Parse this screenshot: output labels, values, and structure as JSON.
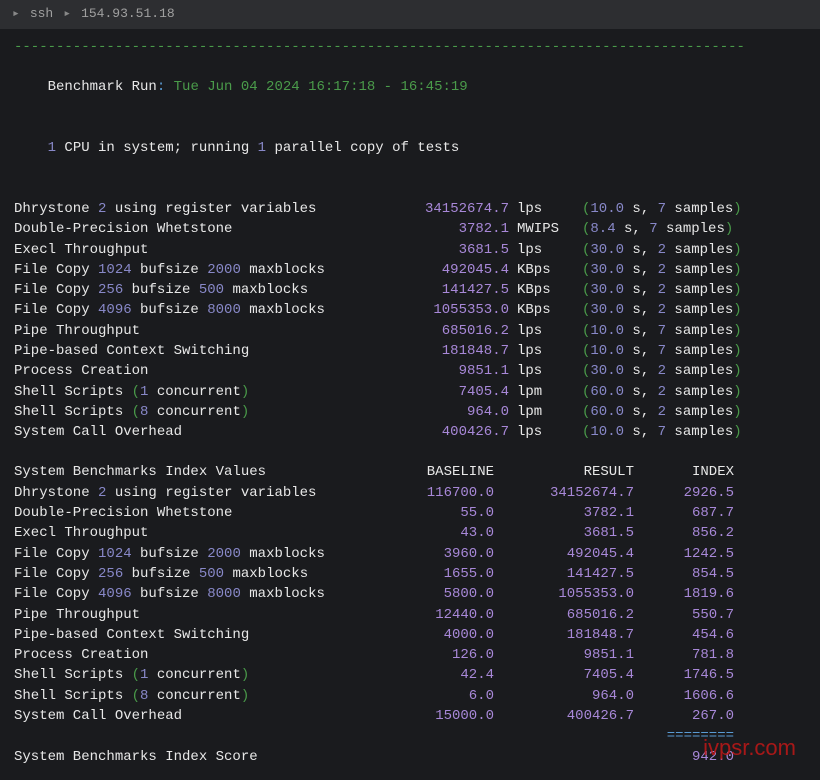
{
  "titlebar": {
    "label_ssh": "ssh",
    "ip": "154.93.51.18",
    "arrow": "▸"
  },
  "header": {
    "dashes": "---------------------------------------------------------------------------------------",
    "run_label": "Benchmark Run",
    "run_time": "Tue Jun 04 2024 16:17:18 - 16:45:19",
    "cpu_count": "1",
    "cpu_text1": " CPU in system; running ",
    "copies": "1",
    "cpu_text2": " parallel copy of tests"
  },
  "tests": [
    {
      "name_parts": [
        {
          "t": "Dhrystone ",
          "c": "c-white"
        },
        {
          "t": "2",
          "c": "c-num"
        },
        {
          "t": " using register variables",
          "c": "c-white"
        }
      ],
      "value": "34152674.7",
      "unit": "lps",
      "time": "10.0",
      "samples": "7"
    },
    {
      "name_parts": [
        {
          "t": "Double-Precision Whetstone",
          "c": "c-white"
        }
      ],
      "value": "3782.1",
      "unit": "MWIPS",
      "time": "8.4",
      "samples": "7"
    },
    {
      "name_parts": [
        {
          "t": "Execl Throughput",
          "c": "c-white"
        }
      ],
      "value": "3681.5",
      "unit": "lps",
      "time": "30.0",
      "samples": "2"
    },
    {
      "name_parts": [
        {
          "t": "File Copy ",
          "c": "c-white"
        },
        {
          "t": "1024",
          "c": "c-num"
        },
        {
          "t": " bufsize ",
          "c": "c-white"
        },
        {
          "t": "2000",
          "c": "c-num"
        },
        {
          "t": " maxblocks",
          "c": "c-white"
        }
      ],
      "value": "492045.4",
      "unit": "KBps",
      "time": "30.0",
      "samples": "2"
    },
    {
      "name_parts": [
        {
          "t": "File Copy ",
          "c": "c-white"
        },
        {
          "t": "256",
          "c": "c-num"
        },
        {
          "t": " bufsize ",
          "c": "c-white"
        },
        {
          "t": "500",
          "c": "c-num"
        },
        {
          "t": " maxblocks",
          "c": "c-white"
        }
      ],
      "value": "141427.5",
      "unit": "KBps",
      "time": "30.0",
      "samples": "2"
    },
    {
      "name_parts": [
        {
          "t": "File Copy ",
          "c": "c-white"
        },
        {
          "t": "4096",
          "c": "c-num"
        },
        {
          "t": " bufsize ",
          "c": "c-white"
        },
        {
          "t": "8000",
          "c": "c-num"
        },
        {
          "t": " maxblocks",
          "c": "c-white"
        }
      ],
      "value": "1055353.0",
      "unit": "KBps",
      "time": "30.0",
      "samples": "2"
    },
    {
      "name_parts": [
        {
          "t": "Pipe Throughput",
          "c": "c-white"
        }
      ],
      "value": "685016.2",
      "unit": "lps",
      "time": "10.0",
      "samples": "7"
    },
    {
      "name_parts": [
        {
          "t": "Pipe-based Context Switching",
          "c": "c-white"
        }
      ],
      "value": "181848.7",
      "unit": "lps",
      "time": "10.0",
      "samples": "7"
    },
    {
      "name_parts": [
        {
          "t": "Process Creation",
          "c": "c-white"
        }
      ],
      "value": "9851.1",
      "unit": "lps",
      "time": "30.0",
      "samples": "2"
    },
    {
      "name_parts": [
        {
          "t": "Shell Scripts ",
          "c": "c-white"
        },
        {
          "t": "(",
          "c": "c-green"
        },
        {
          "t": "1",
          "c": "c-num"
        },
        {
          "t": " concurrent",
          "c": "c-white"
        },
        {
          "t": ")",
          "c": "c-green"
        }
      ],
      "value": "7405.4",
      "unit": "lpm",
      "time": "60.0",
      "samples": "2"
    },
    {
      "name_parts": [
        {
          "t": "Shell Scripts ",
          "c": "c-white"
        },
        {
          "t": "(",
          "c": "c-green"
        },
        {
          "t": "8",
          "c": "c-num"
        },
        {
          "t": " concurrent",
          "c": "c-white"
        },
        {
          "t": ")",
          "c": "c-green"
        }
      ],
      "value": "964.0",
      "unit": "lpm",
      "time": "60.0",
      "samples": "2"
    },
    {
      "name_parts": [
        {
          "t": "System Call Overhead",
          "c": "c-white"
        }
      ],
      "value": "400426.7",
      "unit": "lps",
      "time": "10.0",
      "samples": "7"
    }
  ],
  "test_det": {
    "open": "(",
    "close": ")",
    "s": " s, ",
    "samples": " samples"
  },
  "index_header": {
    "name": "System Benchmarks Index Values",
    "base": "BASELINE",
    "res": "RESULT",
    "idx": "INDEX"
  },
  "indices": [
    {
      "name_parts": [
        {
          "t": "Dhrystone ",
          "c": "c-white"
        },
        {
          "t": "2",
          "c": "c-num"
        },
        {
          "t": " using register variables",
          "c": "c-white"
        }
      ],
      "base": "116700.0",
      "res": "34152674.7",
      "idx": "2926.5"
    },
    {
      "name_parts": [
        {
          "t": "Double-Precision Whetstone",
          "c": "c-white"
        }
      ],
      "base": "55.0",
      "res": "3782.1",
      "idx": "687.7"
    },
    {
      "name_parts": [
        {
          "t": "Execl Throughput",
          "c": "c-white"
        }
      ],
      "base": "43.0",
      "res": "3681.5",
      "idx": "856.2"
    },
    {
      "name_parts": [
        {
          "t": "File Copy ",
          "c": "c-white"
        },
        {
          "t": "1024",
          "c": "c-num"
        },
        {
          "t": " bufsize ",
          "c": "c-white"
        },
        {
          "t": "2000",
          "c": "c-num"
        },
        {
          "t": " maxblocks",
          "c": "c-white"
        }
      ],
      "base": "3960.0",
      "res": "492045.4",
      "idx": "1242.5"
    },
    {
      "name_parts": [
        {
          "t": "File Copy ",
          "c": "c-white"
        },
        {
          "t": "256",
          "c": "c-num"
        },
        {
          "t": " bufsize ",
          "c": "c-white"
        },
        {
          "t": "500",
          "c": "c-num"
        },
        {
          "t": " maxblocks",
          "c": "c-white"
        }
      ],
      "base": "1655.0",
      "res": "141427.5",
      "idx": "854.5"
    },
    {
      "name_parts": [
        {
          "t": "File Copy ",
          "c": "c-white"
        },
        {
          "t": "4096",
          "c": "c-num"
        },
        {
          "t": " bufsize ",
          "c": "c-white"
        },
        {
          "t": "8000",
          "c": "c-num"
        },
        {
          "t": " maxblocks",
          "c": "c-white"
        }
      ],
      "base": "5800.0",
      "res": "1055353.0",
      "idx": "1819.6"
    },
    {
      "name_parts": [
        {
          "t": "Pipe Throughput",
          "c": "c-white"
        }
      ],
      "base": "12440.0",
      "res": "685016.2",
      "idx": "550.7"
    },
    {
      "name_parts": [
        {
          "t": "Pipe-based Context Switching",
          "c": "c-white"
        }
      ],
      "base": "4000.0",
      "res": "181848.7",
      "idx": "454.6"
    },
    {
      "name_parts": [
        {
          "t": "Process Creation",
          "c": "c-white"
        }
      ],
      "base": "126.0",
      "res": "9851.1",
      "idx": "781.8"
    },
    {
      "name_parts": [
        {
          "t": "Shell Scripts ",
          "c": "c-white"
        },
        {
          "t": "(",
          "c": "c-green"
        },
        {
          "t": "1",
          "c": "c-num"
        },
        {
          "t": " concurrent",
          "c": "c-white"
        },
        {
          "t": ")",
          "c": "c-green"
        }
      ],
      "base": "42.4",
      "res": "7405.4",
      "idx": "1746.5"
    },
    {
      "name_parts": [
        {
          "t": "Shell Scripts ",
          "c": "c-white"
        },
        {
          "t": "(",
          "c": "c-green"
        },
        {
          "t": "8",
          "c": "c-num"
        },
        {
          "t": " concurrent",
          "c": "c-white"
        },
        {
          "t": ")",
          "c": "c-green"
        }
      ],
      "base": "6.0",
      "res": "964.0",
      "idx": "1606.6"
    },
    {
      "name_parts": [
        {
          "t": "System Call Overhead",
          "c": "c-white"
        }
      ],
      "base": "15000.0",
      "res": "400426.7",
      "idx": "267.0"
    }
  ],
  "footer": {
    "eq": "========",
    "label": "System Benchmarks Index Score",
    "score": "942.0"
  },
  "watermark": "ivpsr.com"
}
